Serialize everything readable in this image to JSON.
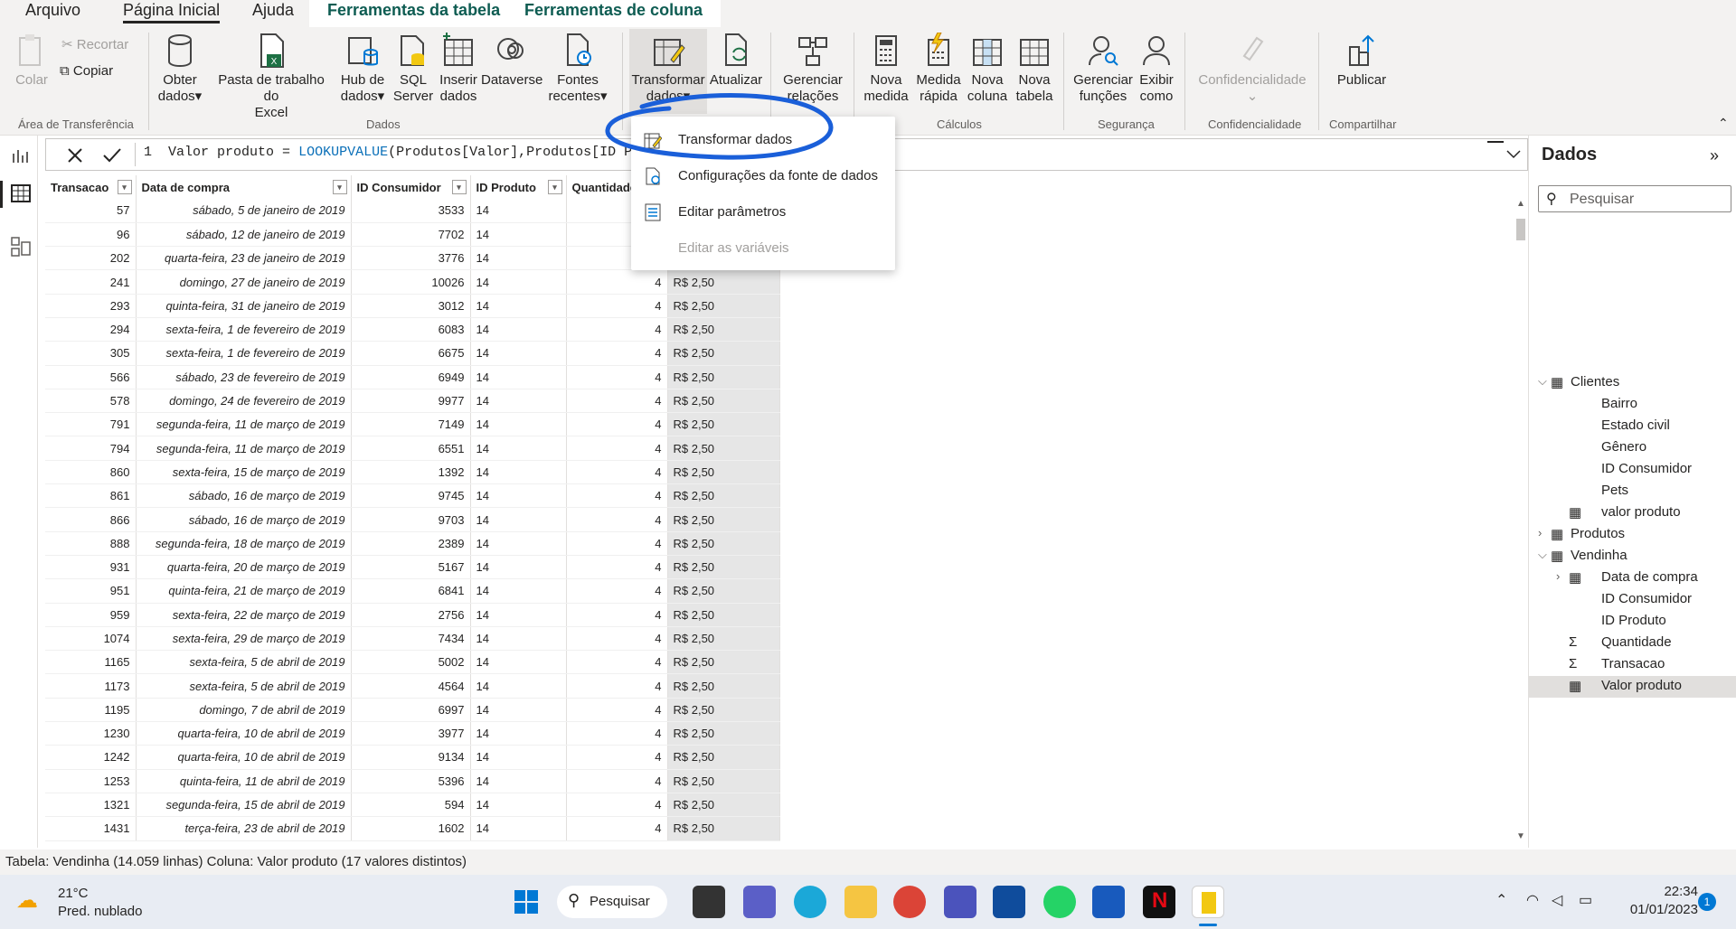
{
  "tabs": {
    "arquivo": "Arquivo",
    "inicio": "Página Inicial",
    "ajuda": "Ajuda",
    "ferr_tabela": "Ferramentas da tabela",
    "ferr_coluna": "Ferramentas de coluna"
  },
  "ribbon": {
    "colar": "Colar",
    "recortar": "Recortar",
    "copiar": "Copiar",
    "obter": [
      "Obter",
      "dados"
    ],
    "excel": [
      "Pasta de trabalho do",
      "Excel"
    ],
    "hub": [
      "Hub de",
      "dados"
    ],
    "sql": [
      "SQL",
      "Server"
    ],
    "inserir": [
      "Inserir",
      "dados"
    ],
    "dataverse": "Dataverse",
    "fontes": [
      "Fontes",
      "recentes"
    ],
    "transformar": [
      "Transformar",
      "dados"
    ],
    "atualizar": "Atualizar",
    "gerenciar_rel": [
      "Gerenciar",
      "relações"
    ],
    "nova_medida": [
      "Nova",
      "medida"
    ],
    "medida_rapida": [
      "Medida",
      "rápida"
    ],
    "nova_coluna": [
      "Nova",
      "coluna"
    ],
    "nova_tabela": [
      "Nova",
      "tabela"
    ],
    "gerenciar_func": [
      "Gerenciar",
      "funções"
    ],
    "exibir_como": [
      "Exibir",
      "como"
    ],
    "confidencialidade": "Confidencialidade",
    "publicar": "Publicar",
    "groups": {
      "transf": "Área de Transferência",
      "dados": "Dados",
      "calculos": "Cálculos",
      "seguranca": "Segurança",
      "confid": "Confidencialidade",
      "compart": "Compartilhar"
    }
  },
  "formula": {
    "line": "1",
    "prefix": "Valor produto = ",
    "func": "LOOKUPVALUE",
    "args": "(Produtos[Valor],Produtos[ID Produto"
  },
  "menu": {
    "items": [
      "Transformar dados",
      "Configurações da fonte de dados",
      "Editar parâmetros",
      "Editar as variáveis"
    ]
  },
  "table": {
    "headers": [
      "Transacao",
      "Data de compra",
      "ID Consumidor",
      "ID Produto",
      "Quantidade",
      ""
    ],
    "rows": [
      [
        "57",
        "sábado, 5 de janeiro de 2019",
        "3533",
        "14",
        "",
        ""
      ],
      [
        "96",
        "sábado, 12 de janeiro de 2019",
        "7702",
        "14",
        "",
        ""
      ],
      [
        "202",
        "quarta-feira, 23 de janeiro de 2019",
        "3776",
        "14",
        "",
        ""
      ],
      [
        "241",
        "domingo, 27 de janeiro de 2019",
        "10026",
        "14",
        "4",
        "R$ 2,50"
      ],
      [
        "293",
        "quinta-feira, 31 de janeiro de 2019",
        "3012",
        "14",
        "4",
        "R$ 2,50"
      ],
      [
        "294",
        "sexta-feira, 1 de fevereiro de 2019",
        "6083",
        "14",
        "4",
        "R$ 2,50"
      ],
      [
        "305",
        "sexta-feira, 1 de fevereiro de 2019",
        "6675",
        "14",
        "4",
        "R$ 2,50"
      ],
      [
        "566",
        "sábado, 23 de fevereiro de 2019",
        "6949",
        "14",
        "4",
        "R$ 2,50"
      ],
      [
        "578",
        "domingo, 24 de fevereiro de 2019",
        "9977",
        "14",
        "4",
        "R$ 2,50"
      ],
      [
        "791",
        "segunda-feira, 11 de março de 2019",
        "7149",
        "14",
        "4",
        "R$ 2,50"
      ],
      [
        "794",
        "segunda-feira, 11 de março de 2019",
        "6551",
        "14",
        "4",
        "R$ 2,50"
      ],
      [
        "860",
        "sexta-feira, 15 de março de 2019",
        "1392",
        "14",
        "4",
        "R$ 2,50"
      ],
      [
        "861",
        "sábado, 16 de março de 2019",
        "9745",
        "14",
        "4",
        "R$ 2,50"
      ],
      [
        "866",
        "sábado, 16 de março de 2019",
        "9703",
        "14",
        "4",
        "R$ 2,50"
      ],
      [
        "888",
        "segunda-feira, 18 de março de 2019",
        "2389",
        "14",
        "4",
        "R$ 2,50"
      ],
      [
        "931",
        "quarta-feira, 20 de março de 2019",
        "5167",
        "14",
        "4",
        "R$ 2,50"
      ],
      [
        "951",
        "quinta-feira, 21 de março de 2019",
        "6841",
        "14",
        "4",
        "R$ 2,50"
      ],
      [
        "959",
        "sexta-feira, 22 de março de 2019",
        "2756",
        "14",
        "4",
        "R$ 2,50"
      ],
      [
        "1074",
        "sexta-feira, 29 de março de 2019",
        "7434",
        "14",
        "4",
        "R$ 2,50"
      ],
      [
        "1165",
        "sexta-feira, 5 de abril de 2019",
        "5002",
        "14",
        "4",
        "R$ 2,50"
      ],
      [
        "1173",
        "sexta-feira, 5 de abril de 2019",
        "4564",
        "14",
        "4",
        "R$ 2,50"
      ],
      [
        "1195",
        "domingo, 7 de abril de 2019",
        "6997",
        "14",
        "4",
        "R$ 2,50"
      ],
      [
        "1230",
        "quarta-feira, 10 de abril de 2019",
        "3977",
        "14",
        "4",
        "R$ 2,50"
      ],
      [
        "1242",
        "quarta-feira, 10 de abril de 2019",
        "9134",
        "14",
        "4",
        "R$ 2,50"
      ],
      [
        "1253",
        "quinta-feira, 11 de abril de 2019",
        "5396",
        "14",
        "4",
        "R$ 2,50"
      ],
      [
        "1321",
        "segunda-feira, 15 de abril de 2019",
        "594",
        "14",
        "4",
        "R$ 2,50"
      ],
      [
        "1431",
        "terça-feira, 23 de abril de 2019",
        "1602",
        "14",
        "4",
        "R$ 2,50"
      ]
    ]
  },
  "pane": {
    "title": "Dados",
    "search": "Pesquisar",
    "fields": [
      "Clientes",
      "Bairro",
      "Estado civil",
      "Gênero",
      "ID Consumidor",
      "Pets",
      "valor produto",
      "Produtos",
      "Vendinha",
      "Data de compra",
      "ID Consumidor",
      "ID Produto",
      "Quantidade",
      "Transacao",
      "Valor produto"
    ]
  },
  "status": "Tabela: Vendinha (14.059 linhas) Coluna: Valor produto (17 valores distintos)",
  "taskbar": {
    "temp": "21°C",
    "weather": "Pred. nublado",
    "search": "Pesquisar",
    "time": "22:34",
    "date": "01/01/2023",
    "badge": "1"
  },
  "colors": {
    "accent": "#f2c811",
    "annotation": "#1a5fd9"
  }
}
